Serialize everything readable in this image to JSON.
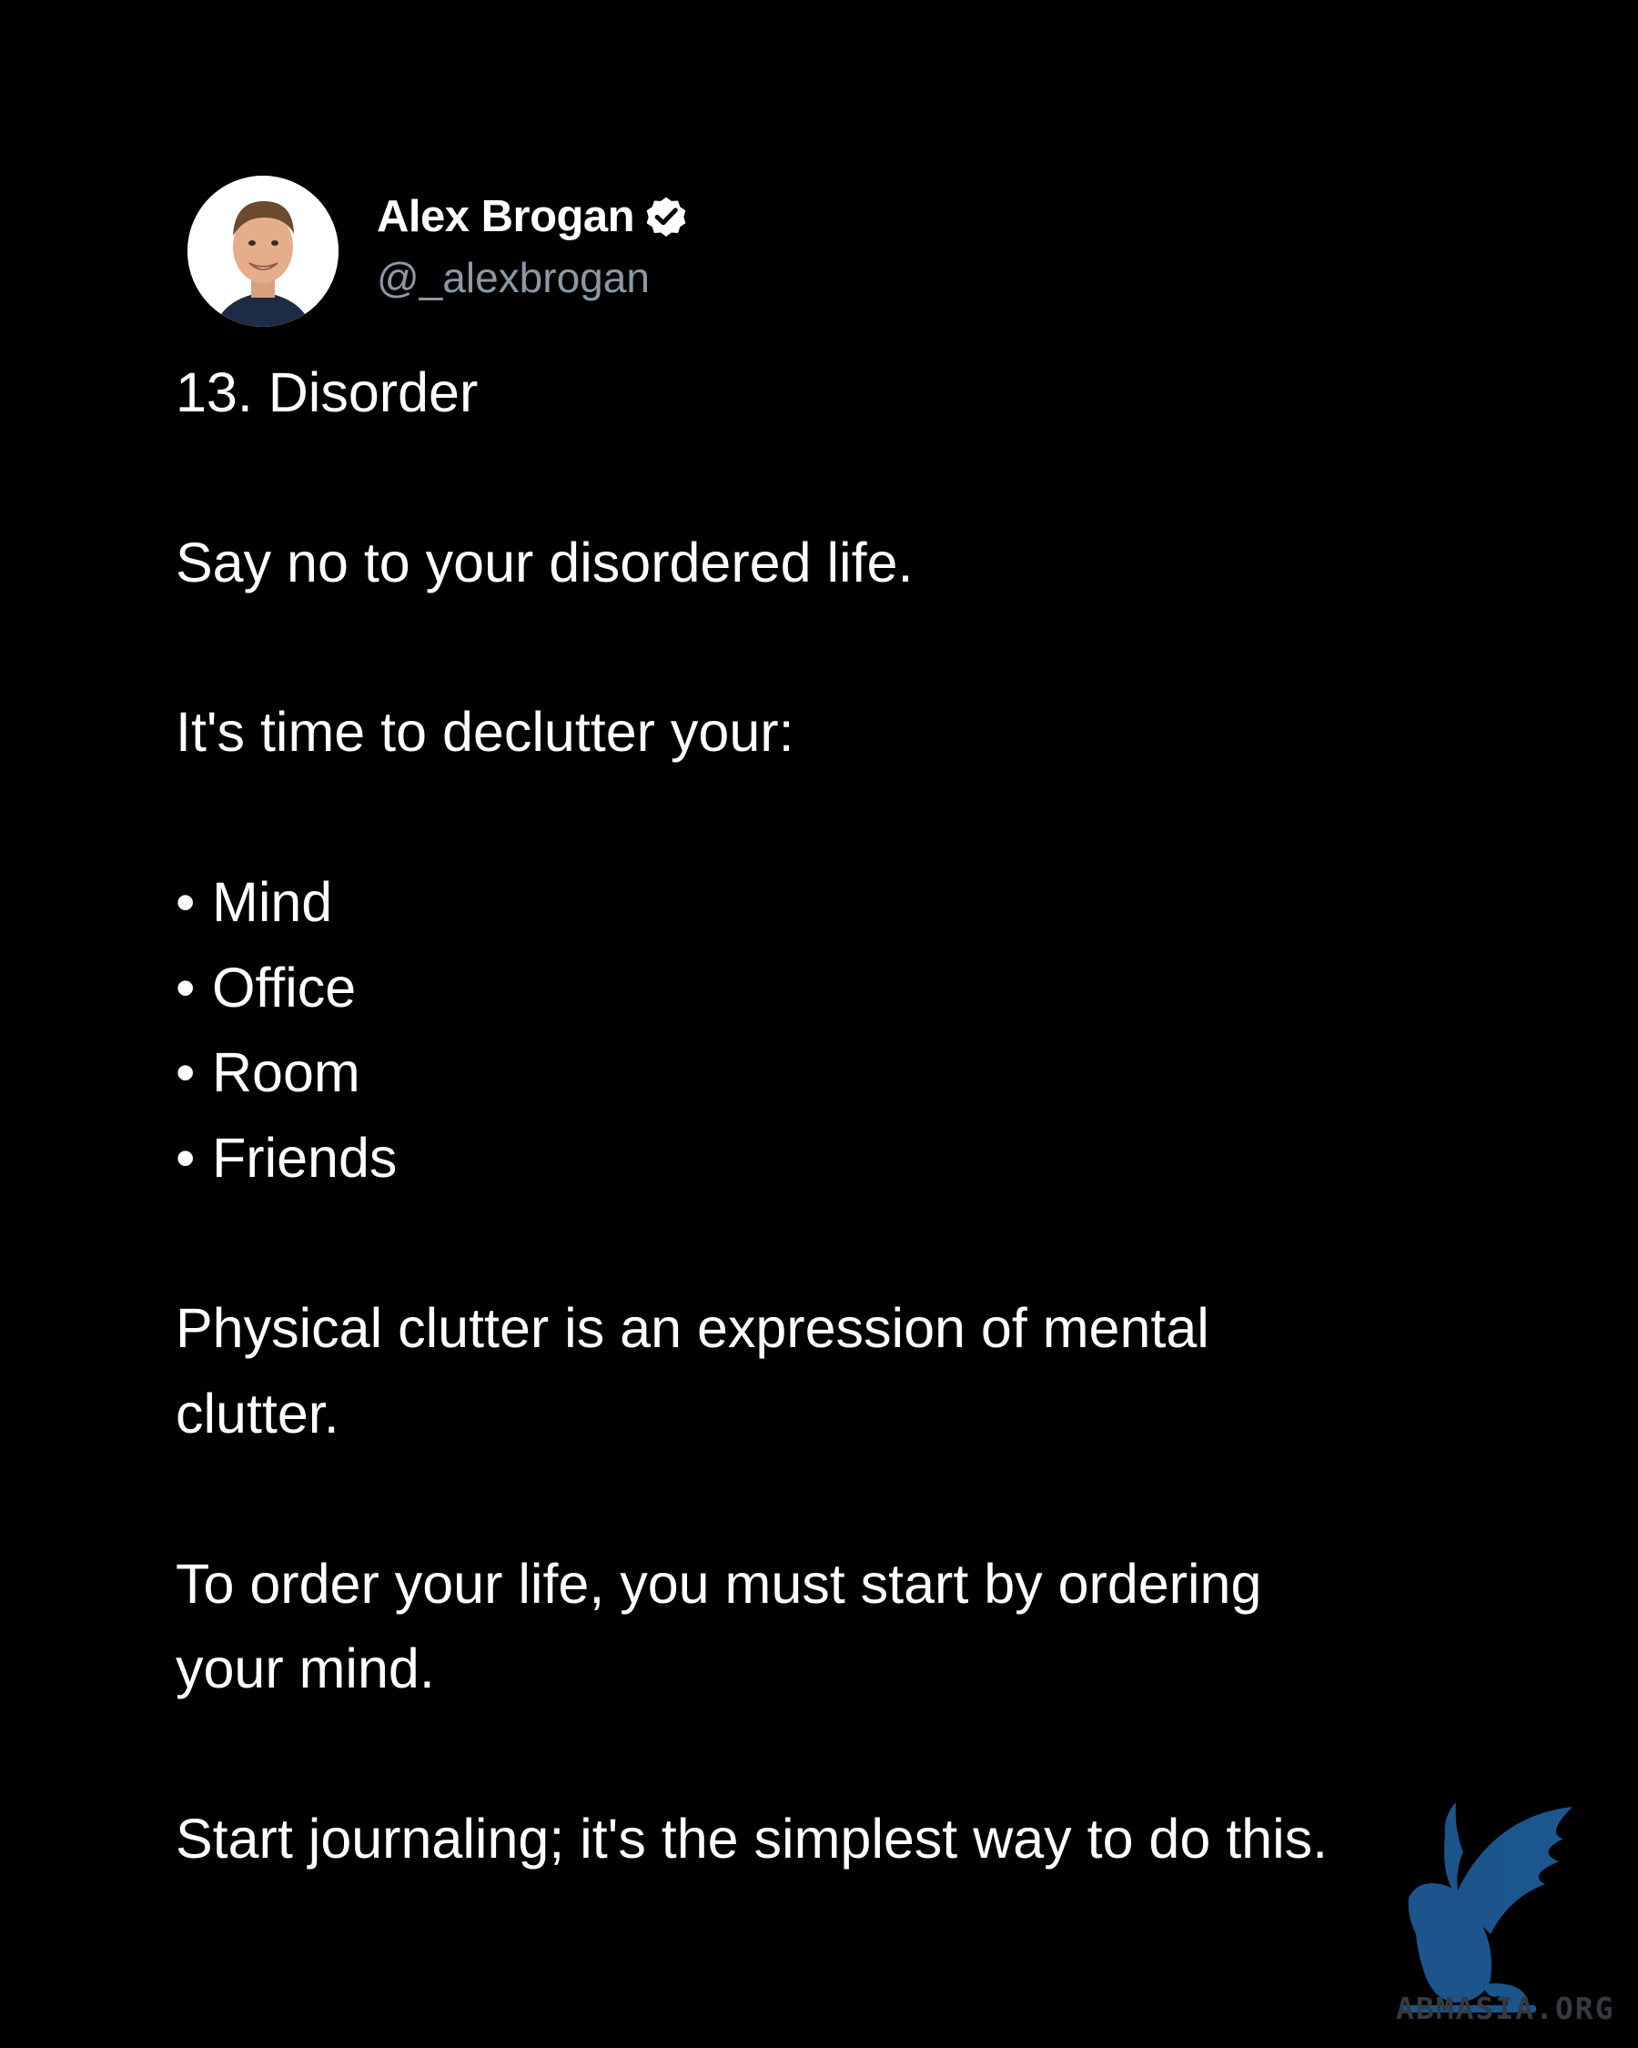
{
  "author": {
    "name": "Alex Brogan",
    "handle": "@_alexbrogan",
    "verified_icon": "verified-badge-icon",
    "avatar_icon": "profile-photo"
  },
  "post": {
    "heading": "13. Disorder",
    "line1": "Say no to your disordered life.",
    "line2": "It's time to declutter your:",
    "bullet_char": "•",
    "bullets": [
      "Mind",
      "Office",
      "Room",
      "Friends"
    ],
    "para1_line1": "Physical clutter is an expression of mental",
    "para1_line2": "clutter.",
    "para2_line1": "To order your life, you must start by ordering",
    "para2_line2": "your mind.",
    "para3": "Start journaling; it's the simplest way to do this."
  },
  "watermark": {
    "text": "ABMASIA.ORG",
    "icon": "griffin-logo",
    "color": "#1e5f9c"
  },
  "colors": {
    "background": "#000000",
    "text": "#ffffff",
    "handle": "#8b98a5"
  }
}
